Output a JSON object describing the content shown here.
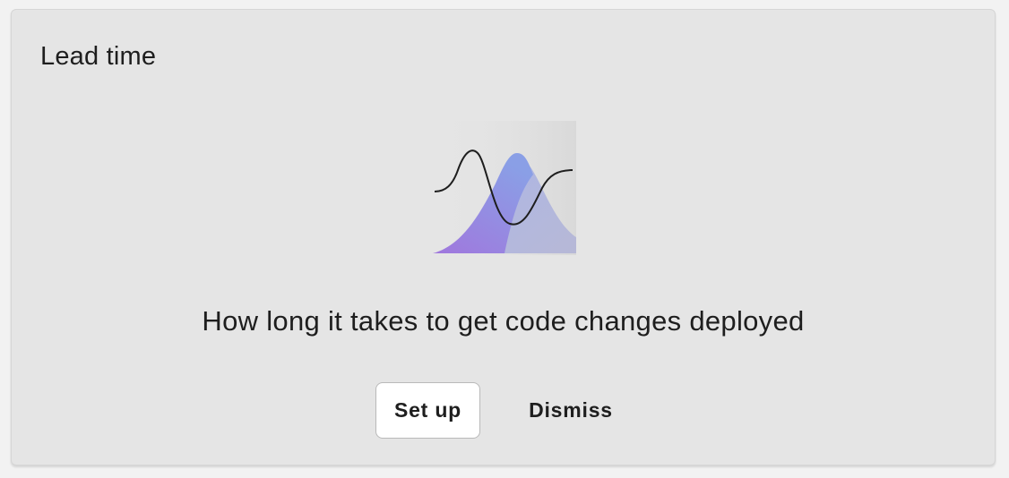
{
  "card": {
    "title": "Lead time",
    "illustration": "distribution-curves-illustration",
    "description": "How long it takes to get code changes deployed",
    "actions": {
      "setup_label": "Set up",
      "dismiss_label": "Dismiss"
    }
  },
  "colors": {
    "card_background": "#e5e5e5",
    "accent_purple": "#9b72e0",
    "accent_blue": "#8fa2e8"
  }
}
